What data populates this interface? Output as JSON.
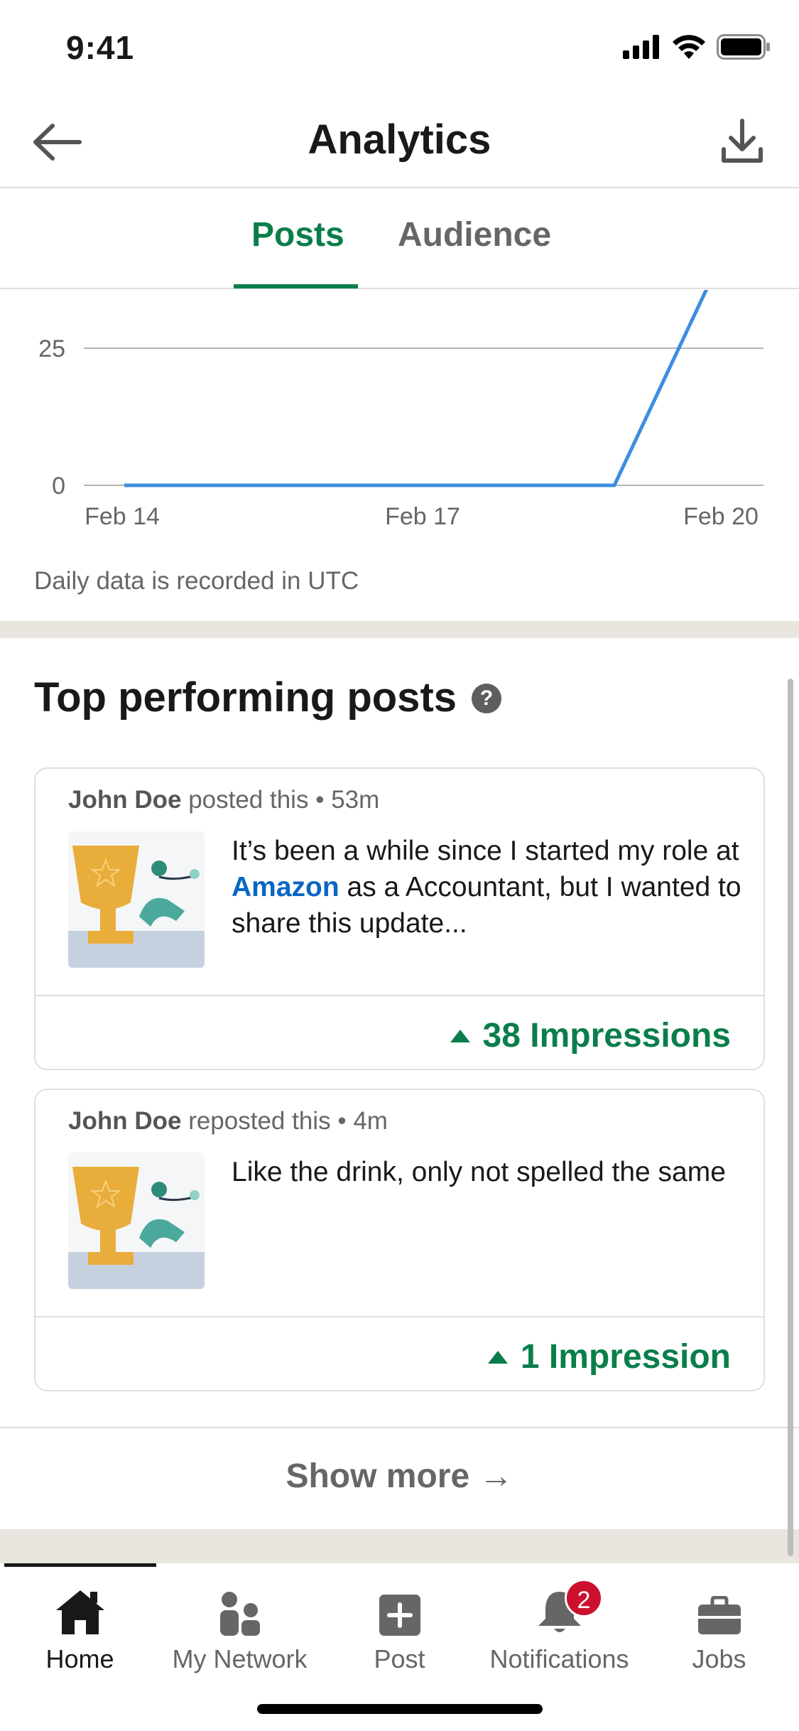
{
  "status_bar": {
    "time": "9:41"
  },
  "header": {
    "title": "Analytics",
    "back_icon": "arrow-left-icon",
    "download_icon": "download-icon"
  },
  "tabs": [
    {
      "label": "Posts",
      "active": true
    },
    {
      "label": "Audience",
      "active": false
    }
  ],
  "chart_data": {
    "type": "line",
    "x_ticks": [
      "Feb 14",
      "Feb 17",
      "Feb 20"
    ],
    "y_ticks": [
      0,
      25
    ],
    "series": [
      {
        "x": [
          "Feb 14",
          "Feb 15",
          "Feb 16",
          "Feb 17",
          "Feb 18",
          "Feb 19",
          "Feb 20"
        ],
        "values": [
          0,
          0,
          0,
          0,
          0,
          0,
          38
        ]
      }
    ],
    "ylim": [
      0,
      25
    ],
    "color": "#3d8ee0",
    "grid": true
  },
  "chart_note": "Daily data is recorded in UTC",
  "top_posts": {
    "title": "Top performing posts",
    "help_symbol": "?",
    "posts": [
      {
        "author": "John Doe",
        "action": "posted this",
        "separator": "•",
        "time": "53m",
        "text_before": "It’s been a while since I started my role at ",
        "link": "Amazon",
        "text_after": " as a Accountant, but I wanted to share this update...",
        "impressions": "38 Impressions"
      },
      {
        "author": "John Doe",
        "action": "reposted this",
        "separator": "•",
        "time": "4m",
        "text_before": "Like the drink, only not spelled the same",
        "link": "",
        "text_after": "",
        "impressions": "1 Impression"
      }
    ],
    "show_more": "Show more →"
  },
  "bottom_nav": {
    "items": [
      {
        "label": "Home",
        "icon": "home-icon",
        "active": true
      },
      {
        "label": "My Network",
        "icon": "people-icon",
        "active": false
      },
      {
        "label": "Post",
        "icon": "plus-square-icon",
        "active": false
      },
      {
        "label": "Notifications",
        "icon": "bell-icon",
        "active": false,
        "badge": "2"
      },
      {
        "label": "Jobs",
        "icon": "briefcase-icon",
        "active": false
      }
    ]
  },
  "colors": {
    "brand_green": "#0a7e4a",
    "link_blue": "#0a66c2",
    "badge_red": "#cb112d",
    "line_blue": "#3d8ee0"
  }
}
